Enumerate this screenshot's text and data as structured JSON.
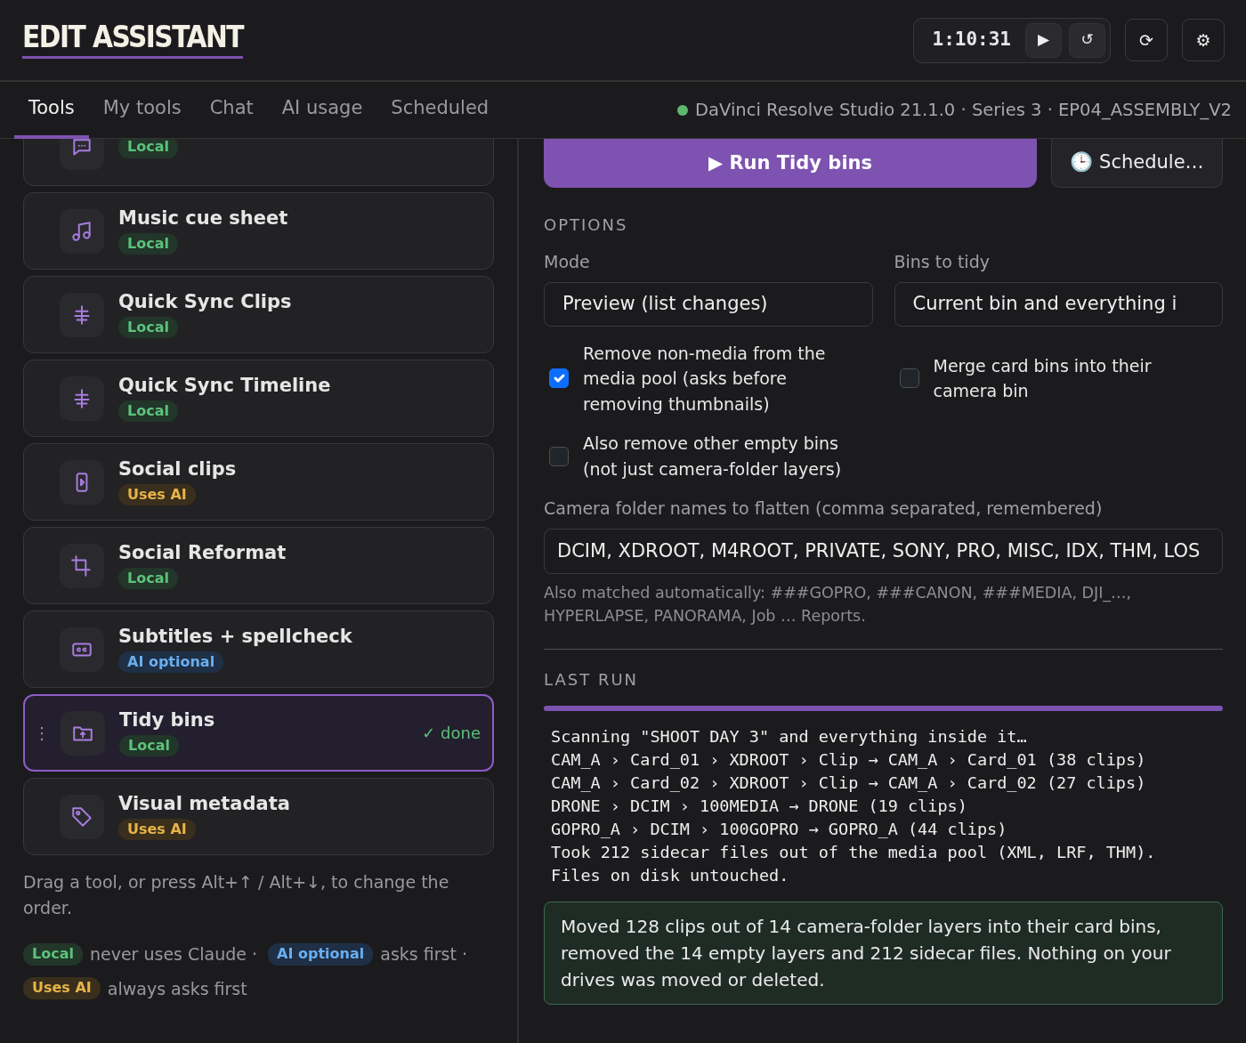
{
  "app": {
    "logo": "EDIT ASSISTANT",
    "timer": "1:10:31",
    "play_icon": "▶",
    "reset_icon": "↺",
    "refresh_icon": "⟳",
    "settings_icon": "⚙"
  },
  "tabs": [
    {
      "label": "Tools",
      "selected": true
    },
    {
      "label": "My tools",
      "selected": false
    },
    {
      "label": "Chat",
      "selected": false
    },
    {
      "label": "AI usage",
      "selected": false
    },
    {
      "label": "Scheduled",
      "selected": false
    }
  ],
  "connection": {
    "color": "#5cb86f",
    "text": "DaVinci Resolve Studio 21.1.0 · Series 3 · EP04_ASSEMBLY_V2"
  },
  "tools": [
    {
      "kind": "chat",
      "badge": {
        "kind": "local",
        "label": "Local"
      },
      "selected": false
    },
    {
      "kind": "music",
      "title": "Music cue sheet",
      "badge": {
        "kind": "local",
        "label": "Local"
      },
      "selected": false
    },
    {
      "kind": "sync",
      "title": "Quick Sync Clips",
      "badge": {
        "kind": "local",
        "label": "Local"
      },
      "selected": false
    },
    {
      "kind": "sync",
      "title": "Quick Sync Timeline",
      "badge": {
        "kind": "local",
        "label": "Local"
      },
      "selected": false
    },
    {
      "kind": "phone",
      "title": "Social clips",
      "badge": {
        "kind": "uses_ai",
        "label": "Uses AI"
      },
      "selected": false
    },
    {
      "kind": "crop",
      "title": "Social Reformat",
      "badge": {
        "kind": "local",
        "label": "Local"
      },
      "selected": false
    },
    {
      "kind": "cc",
      "title": "Subtitles + spellcheck",
      "badge": {
        "kind": "ai_optional",
        "label": "AI optional"
      },
      "selected": false
    },
    {
      "kind": "folder",
      "title": "Tidy bins",
      "badge": {
        "kind": "local",
        "label": "Local"
      },
      "selected": true,
      "handle": "⋮",
      "status": "✓ done"
    },
    {
      "kind": "tag",
      "title": "Visual metadata",
      "badge": {
        "kind": "uses_ai",
        "label": "Uses AI"
      },
      "selected": false
    }
  ],
  "reorder_hint": "Drag a tool, or press Alt+↑ / Alt+↓, to change the order.",
  "legend": [
    {
      "kind": "local",
      "label": "Local",
      "text": "never uses Claude ·"
    },
    {
      "kind": "ai_optional",
      "label": "AI optional",
      "text": "asks first ·"
    },
    {
      "kind": "uses_ai",
      "label": "Uses AI",
      "text": "always asks first"
    }
  ],
  "run_button": "▶ Run Tidy bins",
  "schedule_button": "🕒 Schedule…",
  "options": {
    "heading": "OPTIONS",
    "selects": [
      {
        "label": "Mode",
        "value": "Preview (list changes)"
      },
      {
        "label": "Bins to tidy",
        "value": "Current bin and everything i"
      }
    ],
    "checkboxes": [
      {
        "label": "Remove non-media from the media pool (asks before removing thumbnails)",
        "checked": true
      },
      {
        "label": "Merge card bins into their camera bin",
        "checked": false
      },
      {
        "label": "Also remove other empty bins (not just camera-folder layers)",
        "checked": false
      }
    ],
    "folders_label": "Camera folder names to flatten (comma separated, remembered)",
    "folders_value": "DCIM, XDROOT, M4ROOT, PRIVATE, SONY, PRO, MISC, IDX, THM, LOS",
    "folders_help": "Also matched automatically: ###GOPRO, ###CANON, ###MEDIA, DJI_…, HYPERLAPSE, PANORAMA, Job … Reports."
  },
  "last_run": {
    "heading": "LAST RUN",
    "level": 1,
    "log": [
      "Scanning \"SHOOT DAY 3\" and everything inside it…",
      "CAM_A › Card_01 › XDROOT › Clip → CAM_A › Card_01 (38 clips)",
      "CAM_A › Card_02 › XDROOT › Clip → CAM_A › Card_02 (27 clips)",
      "DRONE › DCIM › 100MEDIA → DRONE (19 clips)",
      "GOPRO_A › DCIM › 100GOPRO → GOPRO_A (44 clips)",
      "Took 212 sidecar files out of the media pool (XML, LRF, THM).",
      "Files on disk untouched."
    ],
    "summary": "Moved 128 clips out of 14 camera-folder layers into their card bins, removed the 14 empty layers and 212 sidecar files. Nothing on your drives was moved or deleted."
  }
}
